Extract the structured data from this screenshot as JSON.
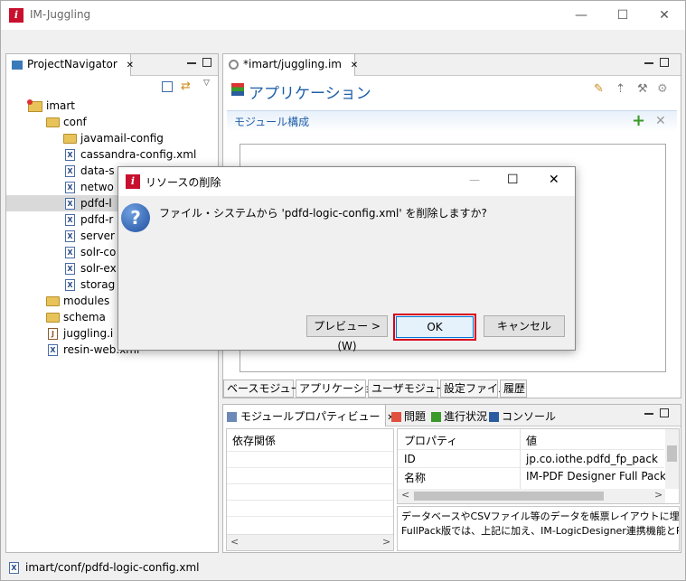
{
  "window": {
    "title": "IM-Juggling",
    "minimize": "—",
    "maximize": "☐",
    "close": "✕"
  },
  "toolbar": {
    "help": "?",
    "info": "i"
  },
  "navigator": {
    "tab_label": "ProjectNavigator",
    "tab_close": "✕",
    "tree": [
      {
        "label": "imart",
        "kind": "project",
        "indent": 0
      },
      {
        "label": "conf",
        "kind": "folder",
        "indent": 1
      },
      {
        "label": "javamail-config",
        "kind": "folder",
        "indent": 2
      },
      {
        "label": "cassandra-config.xml",
        "kind": "xml",
        "indent": 2
      },
      {
        "label": "data-s",
        "kind": "xml",
        "indent": 2
      },
      {
        "label": "netwo",
        "kind": "xml",
        "indent": 2
      },
      {
        "label": "pdfd-l",
        "kind": "xml",
        "indent": 2,
        "selected": true
      },
      {
        "label": "pdfd-r",
        "kind": "xml",
        "indent": 2
      },
      {
        "label": "server",
        "kind": "xml",
        "indent": 2
      },
      {
        "label": "solr-co",
        "kind": "xml",
        "indent": 2
      },
      {
        "label": "solr-ex",
        "kind": "xml",
        "indent": 2
      },
      {
        "label": "storag",
        "kind": "xml",
        "indent": 2
      },
      {
        "label": "modules",
        "kind": "folder",
        "indent": 1
      },
      {
        "label": "schema",
        "kind": "folder",
        "indent": 1
      },
      {
        "label": "juggling.i",
        "kind": "file",
        "indent": 1
      },
      {
        "label": "resin-web.xml",
        "kind": "xml",
        "indent": 1
      }
    ]
  },
  "editor": {
    "tab_label": "*imart/juggling.im",
    "tab_close": "✕",
    "heading": "アプリケーション",
    "section_title": "モジュール構成",
    "add": "+",
    "remove": "✕",
    "bottom_tabs": [
      "ベースモジュール",
      "アプリケーション",
      "ユーザモジュール",
      "設定ファイル",
      "履歴"
    ]
  },
  "bottom_panel": {
    "tabs": [
      {
        "label": "モジュールプロパティビュー",
        "close": "✕"
      },
      {
        "label": "問題"
      },
      {
        "label": "進行状況"
      },
      {
        "label": "コンソール"
      }
    ],
    "deps_header": "依存関係",
    "props_headers": {
      "property": "プロパティ",
      "value": "値"
    },
    "props_rows": [
      {
        "property": "ID",
        "value": "jp.co.iothe.pdfd_fp_pack"
      },
      {
        "property": "名称",
        "value": "IM-PDF Designer Full Pack fo"
      }
    ],
    "description_line1": "データベースやCSVファイル等のデータを帳票レイアウトに埋め込み、",
    "description_line2": "FullPack版では、上記に加え、IM-LogicDesigner連携機能とR",
    "scroll_left": "<",
    "scroll_right": ">"
  },
  "status_bar": {
    "path": "imart/conf/pdfd-logic-config.xml"
  },
  "dialog": {
    "title": "リソースの削除",
    "message": "ファイル・システムから 'pdfd-logic-config.xml' を削除しますか?",
    "question_mark": "?",
    "minimize": "—",
    "maximize": "☐",
    "close": "✕",
    "preview_button": "プレビュー >(W)",
    "ok_button": "OK",
    "cancel_button": "キャンセル"
  },
  "colors": {
    "accent": "#0078d7",
    "heading_blue": "#1f5fa8",
    "ok_border": "#d9001b",
    "add_green": "#3a9a2a"
  }
}
